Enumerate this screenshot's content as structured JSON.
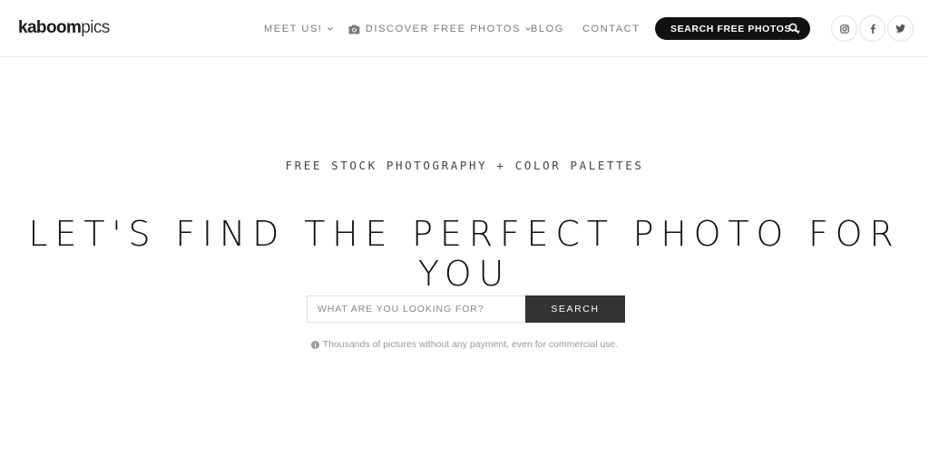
{
  "header": {
    "logo_bold": "kaboom",
    "logo_light": "pics",
    "nav": {
      "meet": "MEET US!",
      "discover": "DISCOVER FREE PHOTOS",
      "blog": "BLOG",
      "contact": "CONTACT"
    },
    "search_pill_label": "SEARCH FREE PHOTOS...",
    "social": [
      "instagram-icon",
      "facebook-icon",
      "twitter-icon"
    ]
  },
  "hero": {
    "eyebrow": "FREE STOCK PHOTOGRAPHY + COLOR PALETTES",
    "headline": "LET'S FIND THE PERFECT PHOTO FOR YOU",
    "search_placeholder": "WHAT ARE YOU LOOKING FOR?",
    "search_button": "SEARCH",
    "note": "Thousands of pictures without any payment, even for commercial use."
  },
  "colors": {
    "pill_bg": "#111111",
    "button_bg": "#333333",
    "nav_text": "#7a7a7a"
  }
}
